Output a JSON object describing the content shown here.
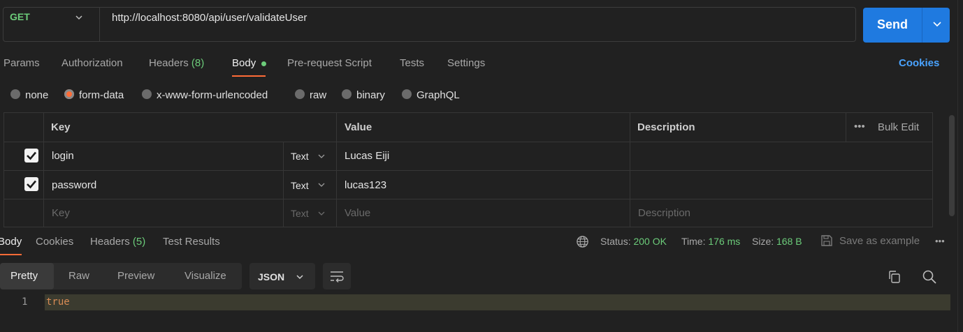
{
  "request": {
    "method": "GET",
    "url": "http://localhost:8080/api/user/validateUser",
    "send_label": "Send"
  },
  "tabs": [
    {
      "label": "Params"
    },
    {
      "label": "Authorization"
    },
    {
      "label": "Headers",
      "count": "(8)"
    },
    {
      "label": "Body"
    },
    {
      "label": "Pre-request Script"
    },
    {
      "label": "Tests"
    },
    {
      "label": "Settings"
    }
  ],
  "cookies_link": "Cookies",
  "body_types": [
    "none",
    "form-data",
    "x-www-form-urlencoded",
    "raw",
    "binary",
    "GraphQL"
  ],
  "body_type_selected": "form-data",
  "table": {
    "headers": {
      "key": "Key",
      "value": "Value",
      "description": "Description",
      "bulk_edit": "Bulk Edit"
    },
    "rows": [
      {
        "checked": true,
        "key": "login",
        "type": "Text",
        "value": "Lucas Eiji",
        "description": ""
      },
      {
        "checked": true,
        "key": "password",
        "type": "Text",
        "value": "lucas123",
        "description": ""
      }
    ],
    "placeholder": {
      "key": "Key",
      "type": "Text",
      "value": "Value",
      "description": "Description"
    }
  },
  "response": {
    "tabs": [
      {
        "label": "Body"
      },
      {
        "label": "Cookies"
      },
      {
        "label": "Headers",
        "count": "(5)"
      },
      {
        "label": "Test Results"
      }
    ],
    "status_label": "Status:",
    "status_value": "200 OK",
    "time_label": "Time:",
    "time_value": "176 ms",
    "size_label": "Size:",
    "size_value": "168 B",
    "save_example": "Save as example",
    "view_tabs": [
      "Pretty",
      "Raw",
      "Preview",
      "Visualize"
    ],
    "format": "JSON",
    "code_lines": [
      {
        "no": "1",
        "text": "true"
      }
    ]
  },
  "colors": {
    "accent": "#ff6c37",
    "send": "#1f7ae0",
    "success": "#6ccc7a",
    "link": "#4aa3ff"
  }
}
